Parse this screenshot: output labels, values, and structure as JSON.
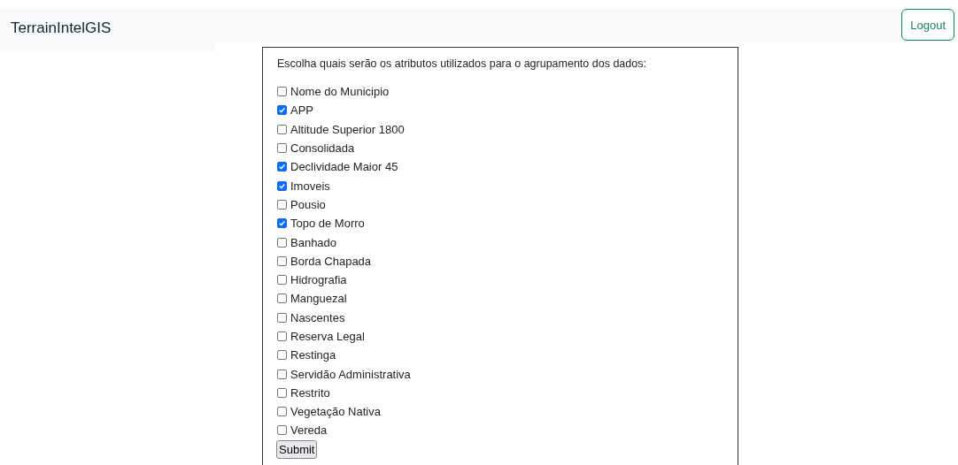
{
  "brand": "TerrainIntelGIS",
  "logout_button": "Logout",
  "form": {
    "prompt": "Escolha quais serão os atributos utilizados para o agrupamento dos dados:",
    "options": [
      {
        "label": "Nome do Municipio",
        "checked": false
      },
      {
        "label": "APP",
        "checked": true
      },
      {
        "label": "Altitude Superior 1800",
        "checked": false
      },
      {
        "label": "Consolidada",
        "checked": false
      },
      {
        "label": "Declividade Maior 45",
        "checked": true
      },
      {
        "label": "Imoveis",
        "checked": true
      },
      {
        "label": "Pousio",
        "checked": false
      },
      {
        "label": "Topo de Morro",
        "checked": true
      },
      {
        "label": "Banhado",
        "checked": false
      },
      {
        "label": "Borda Chapada",
        "checked": false
      },
      {
        "label": "Hidrografia",
        "checked": false
      },
      {
        "label": "Manguezal",
        "checked": false
      },
      {
        "label": "Nascentes",
        "checked": false
      },
      {
        "label": "Reserva Legal",
        "checked": false
      },
      {
        "label": "Restinga",
        "checked": false
      },
      {
        "label": "Servidão Administrativa",
        "checked": false
      },
      {
        "label": "Restrito",
        "checked": false
      },
      {
        "label": "Vegetação Nativa",
        "checked": false
      },
      {
        "label": "Vereda",
        "checked": false
      }
    ],
    "submit_button": "Submit"
  }
}
